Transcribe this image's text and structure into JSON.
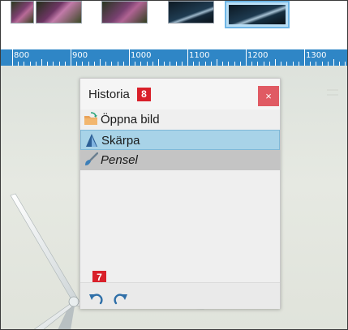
{
  "ruler": {
    "labels": [
      "800",
      "900",
      "1000",
      "1100",
      "1200",
      "1300"
    ]
  },
  "history_panel": {
    "title": "Historia",
    "title_badge": "8",
    "close_label": "×",
    "items": [
      {
        "label": "Öppna bild",
        "icon": "open-folder-icon",
        "state": "normal"
      },
      {
        "label": "Skärpa",
        "icon": "sharpen-icon",
        "state": "selected"
      },
      {
        "label": "Pensel",
        "icon": "brush-icon",
        "state": "pending"
      }
    ],
    "footer_badge": "7",
    "undo_icon": "undo-icon",
    "redo_icon": "redo-icon"
  },
  "colors": {
    "ruler": "#2f86c6",
    "badge": "#d9202a",
    "close": "#e05a63",
    "selected_item": "#a8d3e8",
    "pending_item": "#c4c4c4"
  }
}
